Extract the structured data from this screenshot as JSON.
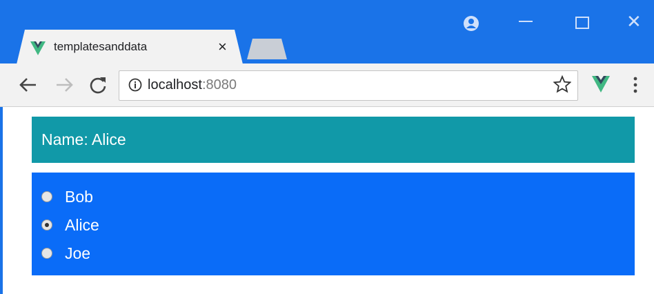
{
  "browser": {
    "tab_title": "templatesanddata",
    "tab_close": "×",
    "window_close": "✕",
    "url_host": "localhost",
    "url_port": ":8080",
    "accent_color": "#1a73e8",
    "icons": [
      "vue-favicon-icon",
      "profile-icon",
      "minimize-icon",
      "maximize-icon",
      "close-icon",
      "back-icon",
      "forward-icon",
      "reload-icon",
      "info-icon",
      "star-icon",
      "vue-extension-icon",
      "menu-icon"
    ]
  },
  "page": {
    "name_label": "Name: Alice",
    "name_panel_color": "#1199a8",
    "radio_panel_color": "#0a6cf8",
    "options": [
      {
        "label": "Bob",
        "checked": false
      },
      {
        "label": "Alice",
        "checked": true
      },
      {
        "label": "Joe",
        "checked": false
      }
    ]
  }
}
